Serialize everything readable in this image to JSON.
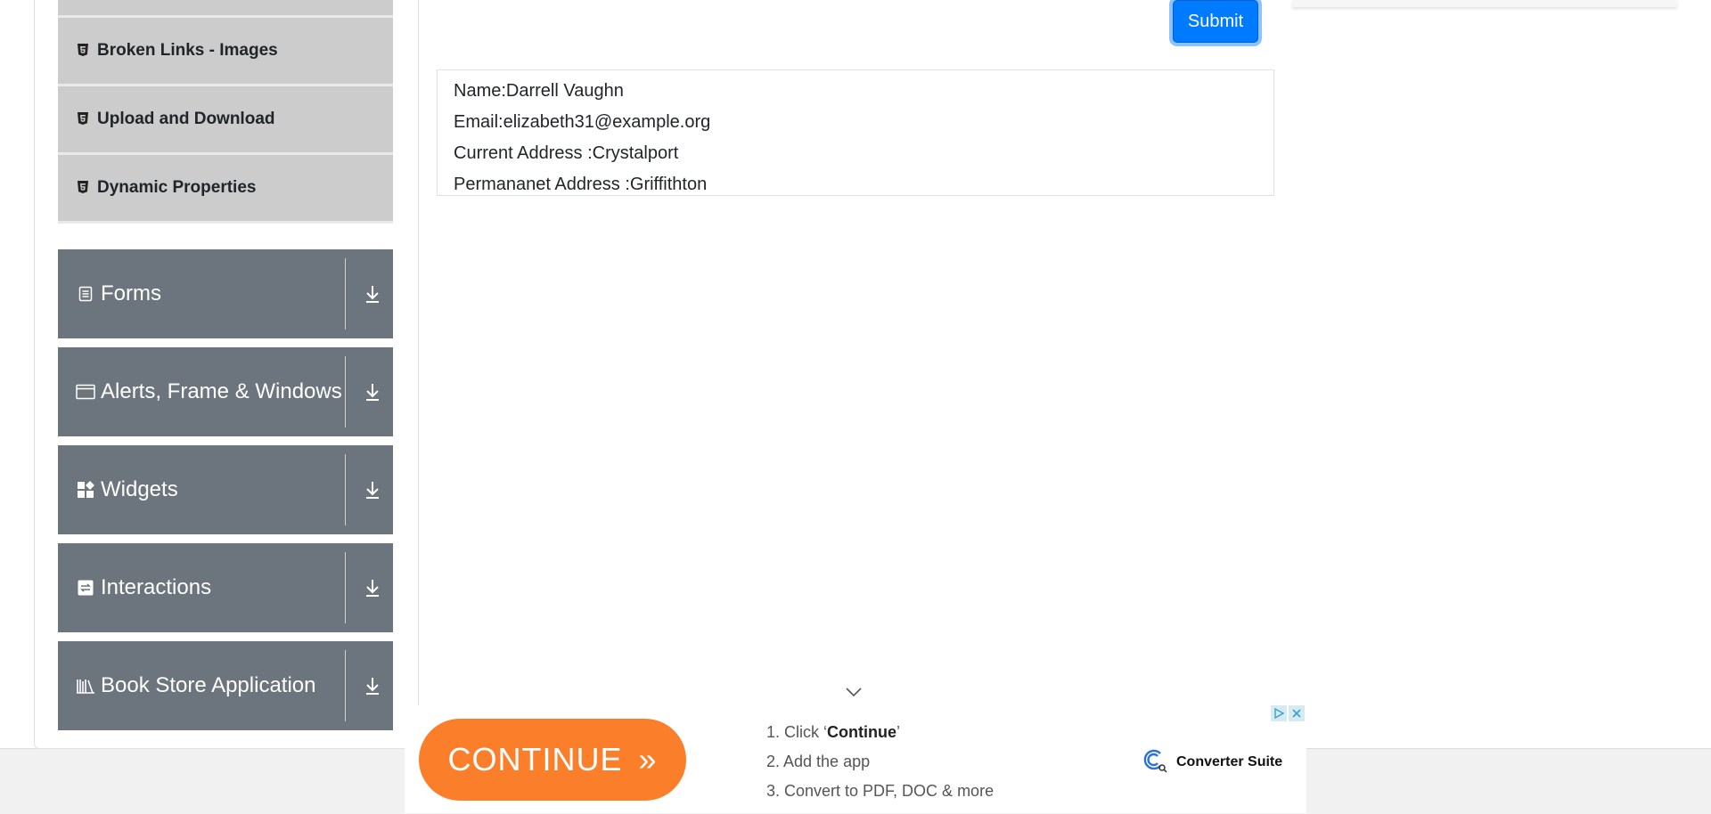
{
  "sidebar": {
    "items": [
      {
        "label": "",
        "icon": "html5-icon"
      },
      {
        "label": "Broken Links - Images",
        "icon": "html5-icon"
      },
      {
        "label": "Upload and Download",
        "icon": "html5-icon"
      },
      {
        "label": "Dynamic Properties",
        "icon": "html5-icon"
      }
    ],
    "groups": [
      {
        "label": "Forms",
        "icon": "document-icon"
      },
      {
        "label": "Alerts, Frame & Windows",
        "icon": "browser-window-icon"
      },
      {
        "label": "Widgets",
        "icon": "widgets-icon"
      },
      {
        "label": "Interactions",
        "icon": "interactions-icon"
      },
      {
        "label": "Book Store Application",
        "icon": "books-icon"
      }
    ]
  },
  "form": {
    "submit_label": "Submit"
  },
  "output": {
    "name": "Name:Darrell Vaughn",
    "email": "Email:elizabeth31@example.org",
    "current_address": "Current Address :Crystalport",
    "permanent_address": "Permananet Address :Griffithton"
  },
  "ad": {
    "continue_label": "CONTINUE",
    "continue_arrows": "»",
    "step1_prefix": "1. Click ‘",
    "step1_bold": "Continue",
    "step1_suffix": "’",
    "step2": "2. Add the app",
    "step3": "3. Convert to PDF, DOC & more",
    "brand": "Converter Suite"
  },
  "colors": {
    "primary": "#007bff",
    "group_bg": "#6c757d",
    "item_bg": "#cccccc",
    "ad_orange": "#fb7f2b"
  }
}
